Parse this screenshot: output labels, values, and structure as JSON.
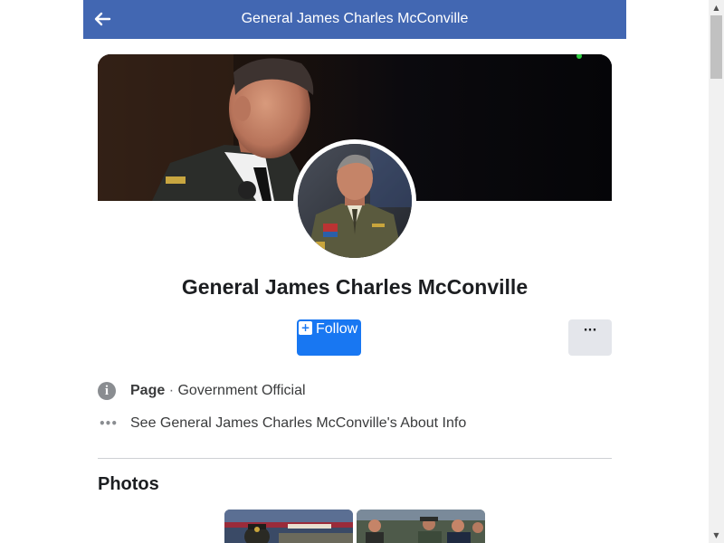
{
  "header": {
    "title": "General James Charles McConville",
    "back_icon": "back-arrow-icon",
    "background_color": "#4267b2"
  },
  "profile": {
    "name": "General James Charles McConville",
    "follow_label": "Follow",
    "follow_icon": "plus-icon",
    "more_label": "···",
    "more_icon": "more-dots-icon",
    "accent_color": "#1877f2"
  },
  "info": {
    "category_icon": "info-icon",
    "category_strong": "Page",
    "category_separator": " · ",
    "category_text": "Government Official",
    "about_icon": "ellipsis-icon",
    "about_text": "See General James Charles McConville's About Info"
  },
  "photos": {
    "heading": "Photos"
  },
  "scrollbar": {
    "up": "▲",
    "down": "▼"
  }
}
